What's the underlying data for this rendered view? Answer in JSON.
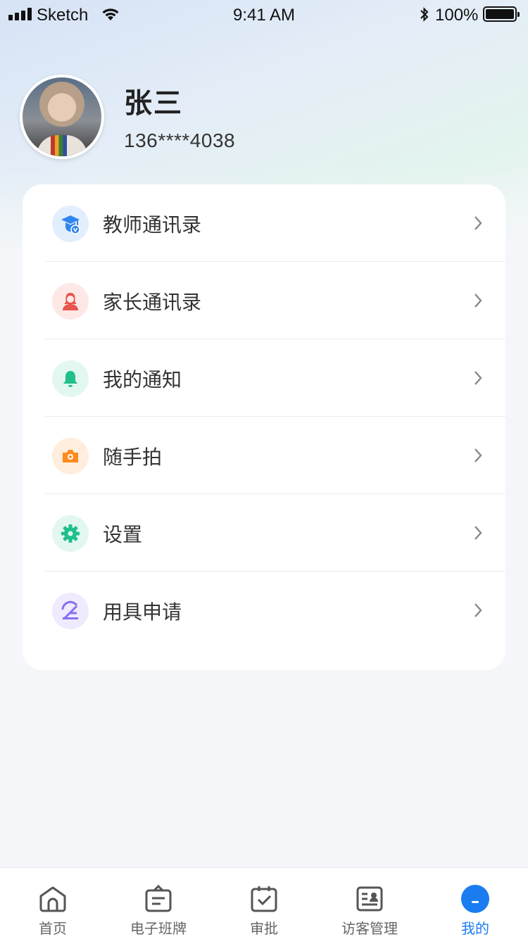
{
  "status_bar": {
    "carrier": "Sketch",
    "time": "9:41 AM",
    "battery": "100%"
  },
  "profile": {
    "name": "张三",
    "phone": "136****4038"
  },
  "menu": [
    {
      "label": "教师通讯录",
      "icon": "teacher-icon",
      "color": "#2f86f0",
      "bg": "#e3eefc"
    },
    {
      "label": "家长通讯录",
      "icon": "parent-icon",
      "color": "#e9564f",
      "bg": "#fde8e6"
    },
    {
      "label": "我的通知",
      "icon": "bell-icon",
      "color": "#21c08a",
      "bg": "#e2f7ef"
    },
    {
      "label": "随手拍",
      "icon": "camera-icon",
      "color": "#ff8a1f",
      "bg": "#ffeedd"
    },
    {
      "label": "设置",
      "icon": "gear-icon",
      "color": "#1fbf8d",
      "bg": "#e2f7ef"
    },
    {
      "label": "用具申请",
      "icon": "tool-request-icon",
      "color": "#8a6ff0",
      "bg": "#efeafd"
    }
  ],
  "tabs": [
    {
      "label": "首页",
      "icon": "home-icon",
      "active": false
    },
    {
      "label": "电子班牌",
      "icon": "class-board-icon",
      "active": false
    },
    {
      "label": "审批",
      "icon": "approval-calendar-icon",
      "active": false
    },
    {
      "label": "访客管理",
      "icon": "visitor-card-icon",
      "active": false
    },
    {
      "label": "我的",
      "icon": "profile-icon",
      "active": true
    }
  ],
  "colors": {
    "accent": "#1a7cf0",
    "text": "#333333",
    "background": "#f4f6f9"
  }
}
